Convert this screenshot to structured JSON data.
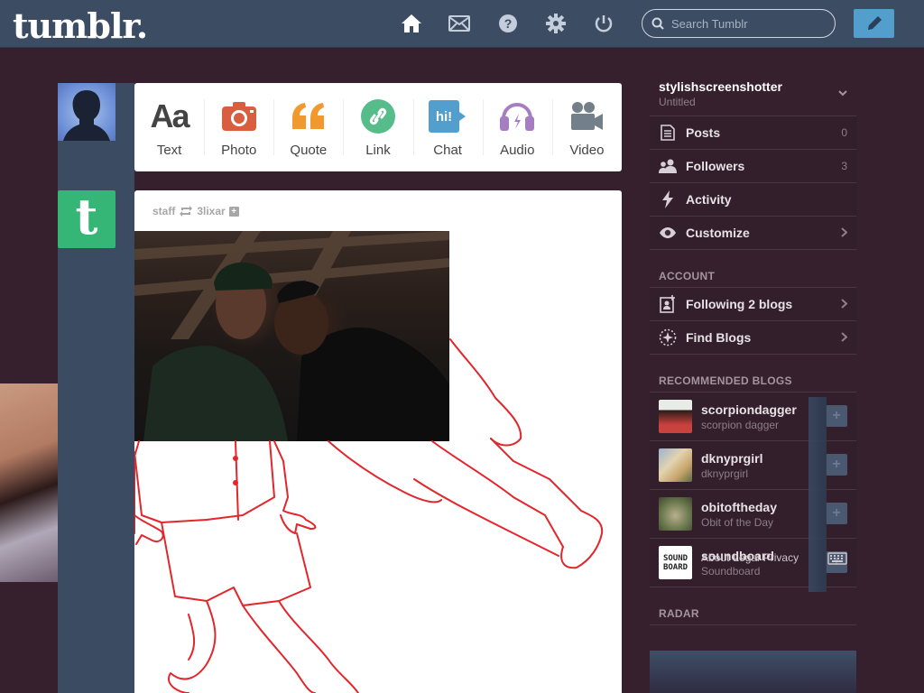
{
  "header": {
    "logo": "tumblr.",
    "nav": [
      {
        "name": "home-icon"
      },
      {
        "name": "mail-icon"
      },
      {
        "name": "help-icon"
      },
      {
        "name": "gear-icon"
      },
      {
        "name": "power-icon"
      }
    ],
    "search_placeholder": "Search Tumblr",
    "compose_icon": "pencil-icon"
  },
  "post_types": [
    {
      "label": "Text",
      "icon": "text-icon",
      "glyph": "Aa",
      "color": "#444444"
    },
    {
      "label": "Photo",
      "icon": "camera-icon",
      "color": "#d95e40"
    },
    {
      "label": "Quote",
      "icon": "quote-icon",
      "glyph": "““",
      "color": "#f2992e"
    },
    {
      "label": "Link",
      "icon": "link-icon",
      "color": "#56bc8a"
    },
    {
      "label": "Chat",
      "icon": "chat-icon",
      "glyph": "hi!",
      "color": "#529ecc"
    },
    {
      "label": "Audio",
      "icon": "headphones-icon",
      "color": "#a77dc2"
    },
    {
      "label": "Video",
      "icon": "video-camera-icon",
      "color": "#748089"
    }
  ],
  "post": {
    "author": "staff",
    "reblogged_from": "3lixar"
  },
  "sidebar": {
    "blog": {
      "name": "stylishscreenshotter",
      "subtitle": "Untitled"
    },
    "stats": [
      {
        "label": "Posts",
        "count": "0",
        "icon": "document-icon"
      },
      {
        "label": "Followers",
        "count": "3",
        "icon": "people-icon"
      },
      {
        "label": "Activity",
        "count": "",
        "icon": "lightning-icon"
      },
      {
        "label": "Customize",
        "count": "",
        "icon": "eye-icon"
      }
    ],
    "account_heading": "ACCOUNT",
    "account_items": [
      {
        "label": "Following 2 blogs",
        "icon": "following-icon"
      },
      {
        "label": "Find Blogs",
        "icon": "compass-icon"
      }
    ],
    "recommended_heading": "RECOMMENDED BLOGS",
    "recommended": [
      {
        "name": "scorpiondagger",
        "title": "scorpion dagger",
        "color": "#c9423d"
      },
      {
        "name": "dknyprgirl",
        "title": "dknyprgirl",
        "color": "#c7a56a"
      },
      {
        "name": "obitoftheday",
        "title": "Obit of the Day",
        "color": "#6d7a4e"
      },
      {
        "name": "soundboard",
        "title": "Soundboard",
        "color": "#ffffff",
        "logo_text": "SOUND BOARD"
      }
    ],
    "footer": [
      "About",
      "Legal",
      "Privacy"
    ],
    "radar_heading": "RADAR"
  }
}
